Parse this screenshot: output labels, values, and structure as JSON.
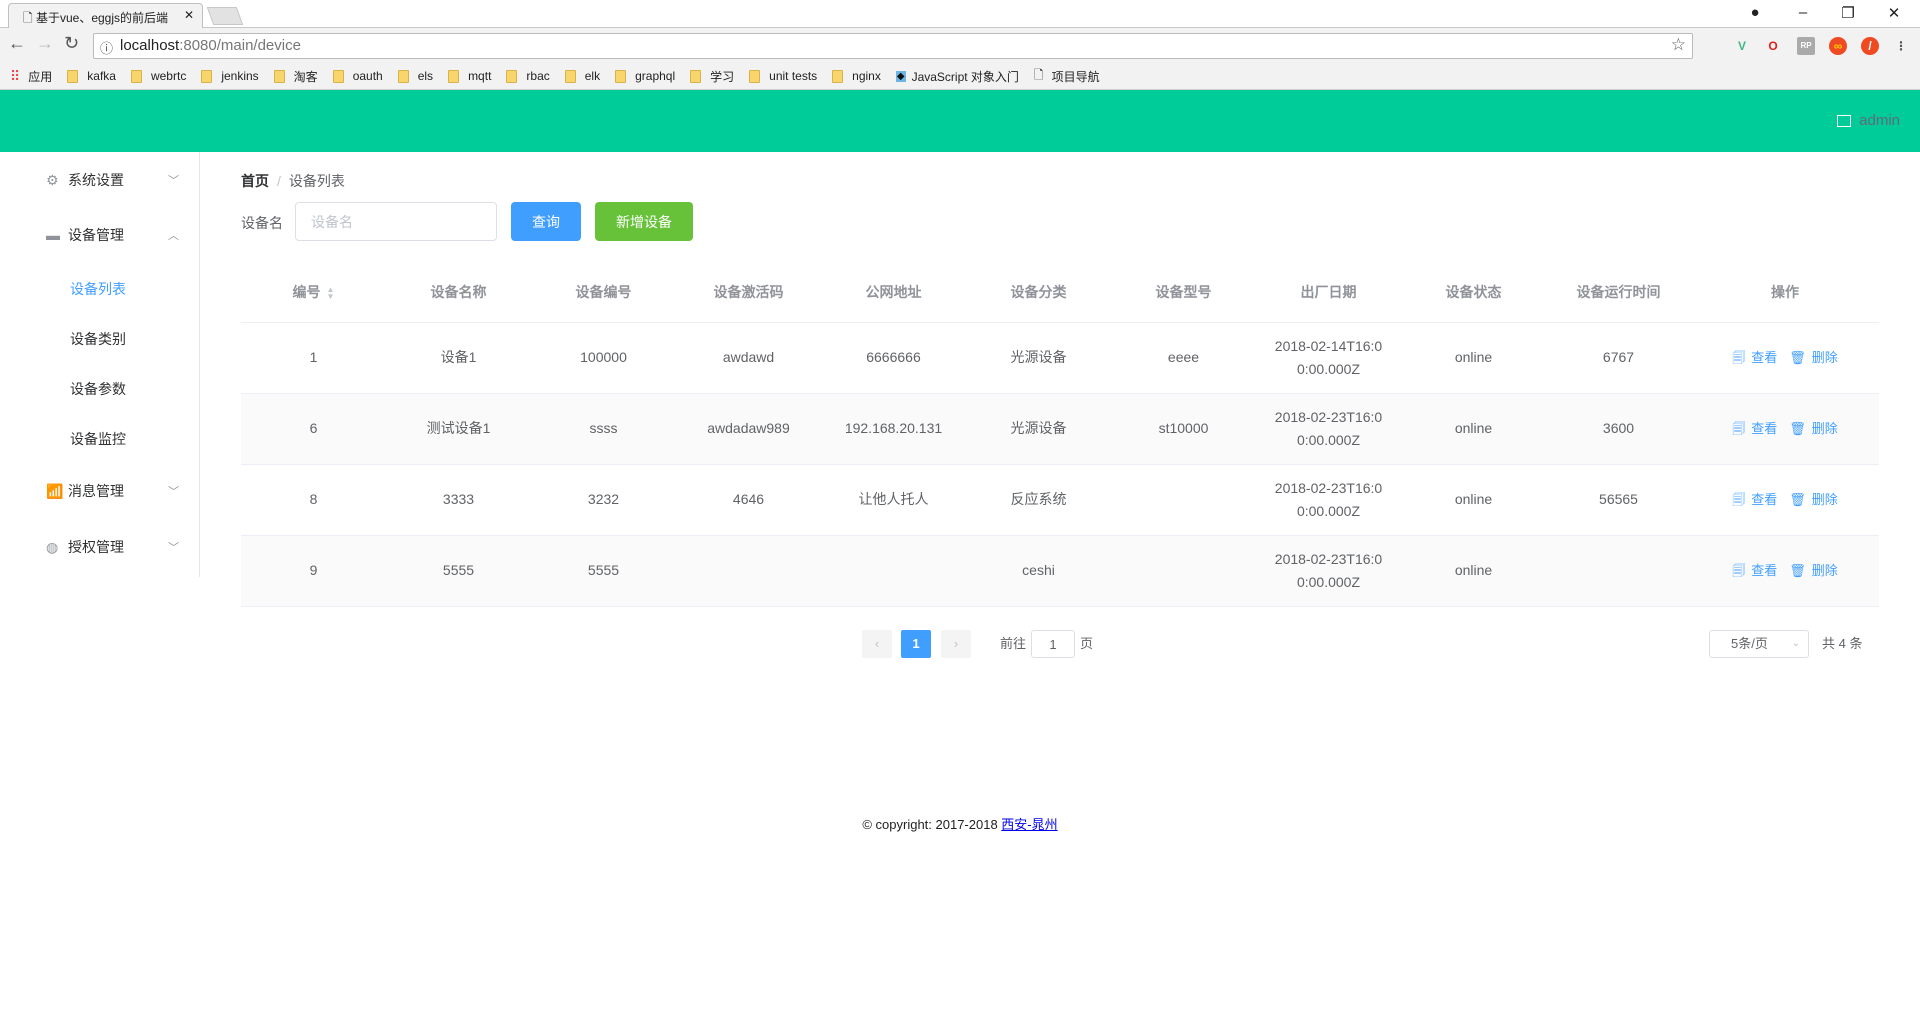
{
  "browser": {
    "tab_title": "基于vue、eggjs的前后端",
    "url_host": "localhost",
    "url_rest": ":8080/main/device",
    "bookmarks": [
      {
        "label": "应用",
        "icon": "apps-icon"
      },
      {
        "label": "kafka",
        "icon": "folder-icon"
      },
      {
        "label": "webrtc",
        "icon": "folder-icon"
      },
      {
        "label": "jenkins",
        "icon": "folder-icon"
      },
      {
        "label": "淘客",
        "icon": "folder-icon"
      },
      {
        "label": "oauth",
        "icon": "folder-icon"
      },
      {
        "label": "els",
        "icon": "folder-icon"
      },
      {
        "label": "mqtt",
        "icon": "folder-icon"
      },
      {
        "label": "rbac",
        "icon": "folder-icon"
      },
      {
        "label": "elk",
        "icon": "folder-icon"
      },
      {
        "label": "graphql",
        "icon": "folder-icon"
      },
      {
        "label": "学习",
        "icon": "folder-icon"
      },
      {
        "label": "unit tests",
        "icon": "folder-icon"
      },
      {
        "label": "nginx",
        "icon": "folder-icon"
      },
      {
        "label": "JavaScript 对象入门",
        "icon": "site-icon"
      },
      {
        "label": "项目导航",
        "icon": "page-icon"
      }
    ]
  },
  "header": {
    "user": "admin",
    "color": "#00cc99"
  },
  "sidebar": {
    "items": [
      {
        "label": "系统设置",
        "icon": "gear-icon",
        "expanded": false
      },
      {
        "label": "设备管理",
        "icon": "device-icon",
        "expanded": true
      },
      {
        "label": "设备列表",
        "active": true
      },
      {
        "label": "设备类别"
      },
      {
        "label": "设备参数"
      },
      {
        "label": "设备监控"
      },
      {
        "label": "消息管理",
        "icon": "chart-icon",
        "expanded": false
      },
      {
        "label": "授权管理",
        "icon": "globe-icon",
        "expanded": false
      }
    ]
  },
  "breadcrumb": {
    "home": "首页",
    "separator": "/",
    "current": "设备列表"
  },
  "search": {
    "label": "设备名",
    "placeholder": "设备名",
    "value": "",
    "query_button": "查询",
    "add_button": "新增设备"
  },
  "table": {
    "columns": [
      "编号",
      "设备名称",
      "设备编号",
      "设备激活码",
      "公网地址",
      "设备分类",
      "设备型号",
      "出厂日期",
      "设备状态",
      "设备运行时间",
      "操作"
    ],
    "rows": [
      [
        "1",
        "设备1",
        "100000",
        "awdawd",
        "6666666",
        "光源设备",
        "eeee",
        "2018-02-14T16:00:00.000Z",
        "online",
        "6767"
      ],
      [
        "6",
        "测试设备1",
        "ssss",
        "awdadaw989",
        "192.168.20.131",
        "光源设备",
        "st10000",
        "2018-02-23T16:00:00.000Z",
        "online",
        "3600"
      ],
      [
        "8",
        "3333",
        "3232",
        "4646",
        "让他人托人",
        "反应系统",
        "",
        "2018-02-23T16:00:00.000Z",
        "online",
        "56565"
      ],
      [
        "9",
        "5555",
        "5555",
        "",
        "",
        "ceshi",
        "",
        "2018-02-23T16:00:00.000Z",
        "online",
        ""
      ]
    ],
    "actions": {
      "view": "查看",
      "delete": "删除"
    }
  },
  "pagination": {
    "current_page": "1",
    "goto_label": "前往",
    "goto_value": "1",
    "page_suffix": "页",
    "page_size": "5条/页",
    "total": "共 4 条"
  },
  "footer": {
    "text": "© copyright: 2017-2018 ",
    "link": "西安-晁州"
  }
}
